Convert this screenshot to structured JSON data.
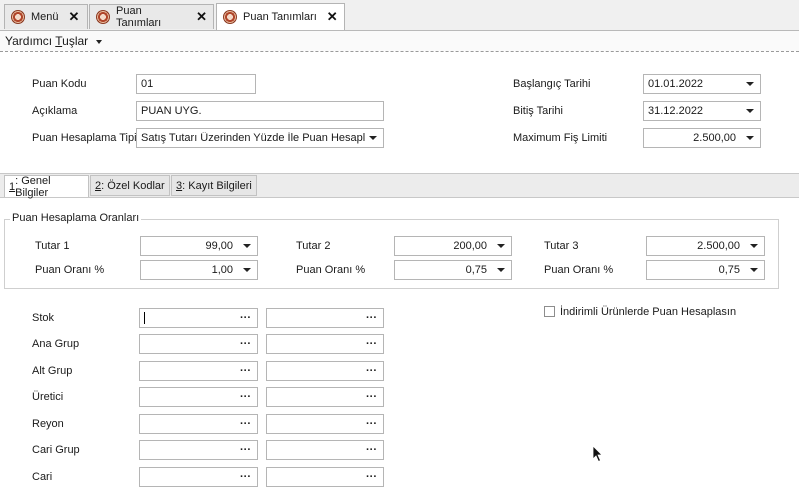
{
  "tabs": [
    {
      "label": "Menü"
    },
    {
      "label": "Puan Tanımları"
    },
    {
      "label": "Puan Tanımları"
    }
  ],
  "menu": {
    "helper_label_pre": "Yardımcı ",
    "helper_label_u": "T",
    "helper_label_post": "uşlar"
  },
  "form": {
    "code_label": "Puan Kodu",
    "code_value": "01",
    "desc_label": "Açıklama",
    "desc_value": "PUAN UYG.",
    "calc_type_label": "Puan Hesaplama Tipi",
    "calc_type_value": "Satış Tutarı Üzerinden Yüzde İle Puan Hesapla",
    "start_date_label": "Başlangıç Tarihi",
    "start_date_value": "01.01.2022",
    "end_date_label": "Bitiş Tarihi",
    "end_date_value": "31.12.2022",
    "max_limit_label": "Maximum Fiş Limiti",
    "max_limit_value": "2.500,00"
  },
  "section_tabs": [
    {
      "num": "1",
      "label": " : Genel Bilgiler"
    },
    {
      "num": "2",
      "label": " : Özel Kodlar"
    },
    {
      "num": "3",
      "label": " : Kayıt Bilgileri"
    }
  ],
  "rates": {
    "title": "Puan Hesaplama Oranları",
    "tutar1_label": "Tutar 1",
    "tutar1_value": "99,00",
    "tutar2_label": "Tutar 2",
    "tutar2_value": "200,00",
    "tutar3_label": "Tutar 3",
    "tutar3_value": "2.500,00",
    "oran1_label": "Puan Oranı %",
    "oran1_value": "1,00",
    "oran2_label": "Puan Oranı %",
    "oran2_value": "0,75",
    "oran3_label": "Puan Oranı %",
    "oran3_value": "0,75"
  },
  "filters": {
    "rows": [
      "Stok",
      "Ana Grup",
      "Alt Grup",
      "Üretici",
      "Reyon",
      "Cari Grup",
      "Cari"
    ],
    "discount_checkbox_label": "İndirimli Ürünlerde Puan Hesaplasın"
  },
  "icons": {
    "tab_icon": "app-logo-icon",
    "close": "close-icon",
    "dropdown": "chevron-down-icon",
    "ellipsis": "ellipsis-icon",
    "cursor": "mouse-pointer-icon"
  }
}
